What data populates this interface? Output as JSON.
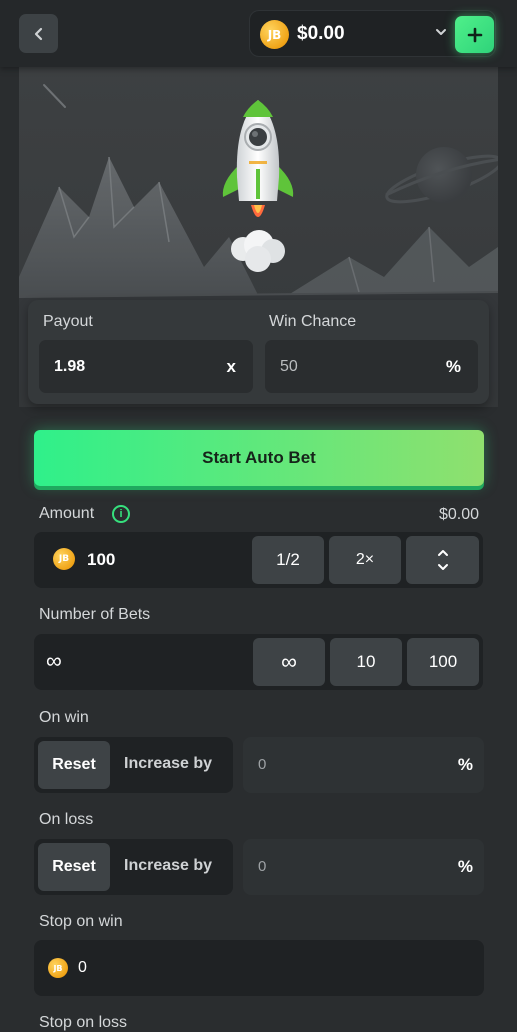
{
  "header": {
    "balance": "$0.00",
    "coin_label": "JB"
  },
  "payout": {
    "label": "Payout",
    "value": "1.98",
    "suffix": "x"
  },
  "win_chance": {
    "label": "Win Chance",
    "value": "50",
    "suffix": "%"
  },
  "start_button": {
    "label": "Start Auto Bet"
  },
  "amount": {
    "label": "Amount",
    "balance": "$0.00",
    "value": "100",
    "half_label": "1/2",
    "double_label": "2×"
  },
  "number_of_bets": {
    "label": "Number of Bets",
    "value": "∞",
    "options": [
      "∞",
      "10",
      "100"
    ]
  },
  "on_win": {
    "label": "On win",
    "reset_label": "Reset",
    "increase_label": "Increase by",
    "value": "0",
    "suffix": "%"
  },
  "on_loss": {
    "label": "On loss",
    "reset_label": "Reset",
    "increase_label": "Increase by",
    "value": "0",
    "suffix": "%"
  },
  "stop_on_win": {
    "label": "Stop on win",
    "value": "0"
  },
  "stop_on_loss": {
    "label": "Stop on loss"
  },
  "colors": {
    "accent_green": "#2ff08a",
    "coin_gold": "#f0a418",
    "background": "#2a2d2f"
  }
}
